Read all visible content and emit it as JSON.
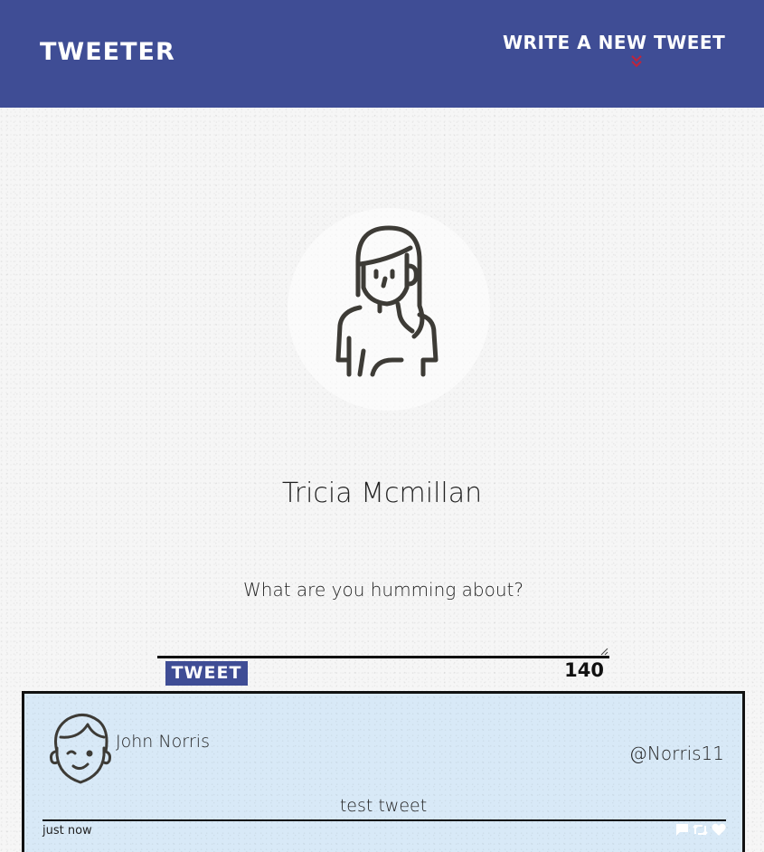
{
  "header": {
    "brand": "TWEETER",
    "compose_label": "WRITE A NEW TWEET",
    "compose_icon": "double-chevron-down-icon",
    "compose_icon_color": "#c0243b",
    "background": "#3f4d95"
  },
  "profile": {
    "avatar_icon": "woman-avatar-icon",
    "name": "Tricia Mcmillan"
  },
  "compose": {
    "placeholder": "What are you humming about?",
    "submit_label": "TWEET",
    "char_count": "140"
  },
  "tweets": [
    {
      "author": "John Norris",
      "handle": "@Norris11",
      "content": "test tweet",
      "timestamp": "just now",
      "avatar_icon": "man-avatar-icon",
      "actions": [
        "flag-icon",
        "retweet-icon",
        "heart-icon"
      ]
    }
  ],
  "colors": {
    "accent": "#3f4d95",
    "tweet_background": "#d8e9f7"
  }
}
